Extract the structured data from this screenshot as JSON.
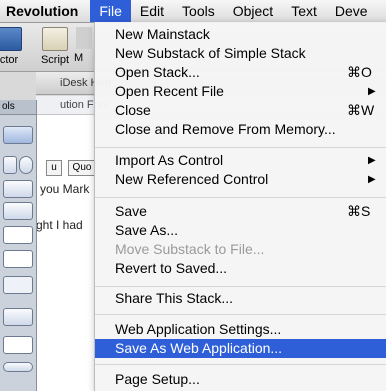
{
  "menubar": {
    "app": "Revolution",
    "items": [
      "File",
      "Edit",
      "Tools",
      "Object",
      "Text",
      "Deve"
    ]
  },
  "toolbar": {
    "buttons": [
      "ctor",
      "Script",
      "M"
    ]
  },
  "background": {
    "doc_title": "iDesk Hon",
    "doc_sub": "ution Foru",
    "tools_title": "ols",
    "format_buttons": [
      "u",
      "Quo"
    ],
    "text_line1": "you Mark",
    "text_line2": "ght I had"
  },
  "file_menu": {
    "new_mainstack": "New Mainstack",
    "new_substack": "New Substack of Simple Stack",
    "open_stack": "Open Stack...",
    "open_stack_sc": "⌘O",
    "open_recent": "Open Recent File",
    "close": "Close",
    "close_sc": "⌘W",
    "close_remove": "Close and Remove From Memory...",
    "import_control": "Import As Control",
    "new_ref_control": "New Referenced Control",
    "save": "Save",
    "save_sc": "⌘S",
    "save_as": "Save As...",
    "move_substack": "Move Substack to File...",
    "revert": "Revert to Saved...",
    "share_stack": "Share This Stack...",
    "web_app_settings": "Web Application Settings...",
    "save_as_web_app": "Save As Web Application...",
    "page_setup": "Page Setup..."
  },
  "colors": {
    "highlight": "#2f5fd8",
    "disabled_text": "#9a9a9a"
  }
}
